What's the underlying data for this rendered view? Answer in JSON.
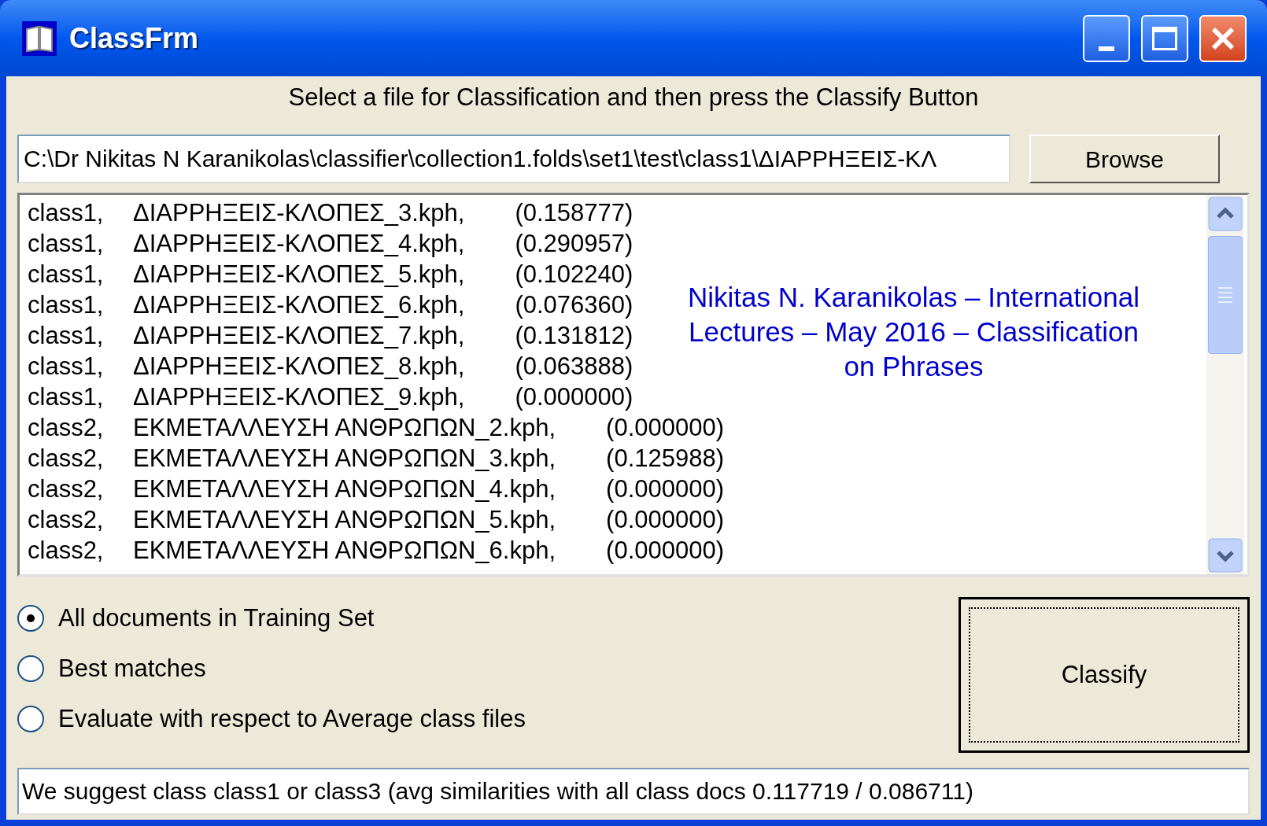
{
  "window": {
    "title": "ClassFrm"
  },
  "instruction": "Select a file for Classification and then press the Classify Button",
  "file_path": {
    "value": "C:\\Dr Nikitas N Karanikolas\\classifier\\collection1.folds\\set1\\test\\class1\\ΔΙΑΡΡΗΞΕΙΣ-ΚΛ"
  },
  "browse_button": "Browse",
  "results": [
    {
      "class": "class1,",
      "file": "ΔΙΑΡΡΗΞΕΙΣ-ΚΛΟΠΕΣ_3.kph,",
      "score": "(0.158777)"
    },
    {
      "class": "class1,",
      "file": "ΔΙΑΡΡΗΞΕΙΣ-ΚΛΟΠΕΣ_4.kph,",
      "score": "(0.290957)"
    },
    {
      "class": "class1,",
      "file": "ΔΙΑΡΡΗΞΕΙΣ-ΚΛΟΠΕΣ_5.kph,",
      "score": "(0.102240)"
    },
    {
      "class": "class1,",
      "file": "ΔΙΑΡΡΗΞΕΙΣ-ΚΛΟΠΕΣ_6.kph,",
      "score": "(0.076360)"
    },
    {
      "class": "class1,",
      "file": "ΔΙΑΡΡΗΞΕΙΣ-ΚΛΟΠΕΣ_7.kph,",
      "score": "(0.131812)"
    },
    {
      "class": "class1,",
      "file": "ΔΙΑΡΡΗΞΕΙΣ-ΚΛΟΠΕΣ_8.kph,",
      "score": "(0.063888)"
    },
    {
      "class": "class1,",
      "file": "ΔΙΑΡΡΗΞΕΙΣ-ΚΛΟΠΕΣ_9.kph,",
      "score": "(0.000000)"
    },
    {
      "class": "class2,",
      "file": "ΕΚΜΕΤΑΛΛΕΥΣΗ ΑΝΘΡΩΠΩΝ_2.kph,",
      "score": "(0.000000)"
    },
    {
      "class": "class2,",
      "file": "ΕΚΜΕΤΑΛΛΕΥΣΗ ΑΝΘΡΩΠΩΝ_3.kph,",
      "score": "(0.125988)"
    },
    {
      "class": "class2,",
      "file": "ΕΚΜΕΤΑΛΛΕΥΣΗ ΑΝΘΡΩΠΩΝ_4.kph,",
      "score": "(0.000000)"
    },
    {
      "class": "class2,",
      "file": "ΕΚΜΕΤΑΛΛΕΥΣΗ ΑΝΘΡΩΠΩΝ_5.kph,",
      "score": "(0.000000)"
    },
    {
      "class": "class2,",
      "file": "ΕΚΜΕΤΑΛΛΕΥΣΗ ΑΝΘΡΩΠΩΝ_6.kph,",
      "score": "(0.000000)"
    }
  ],
  "caption": "Nikitas N. Karanikolas – International Lectures – May 2016 – Classification on Phrases",
  "options": [
    {
      "label": "All documents in Training Set",
      "selected": true
    },
    {
      "label": "Best matches",
      "selected": false
    },
    {
      "label": "Evaluate with respect to Average class files",
      "selected": false
    }
  ],
  "classify_button": "Classify",
  "status": {
    "value": "We suggest class class1 or class3 (avg similarities with all class docs 0.117719 / 0.086711)"
  }
}
